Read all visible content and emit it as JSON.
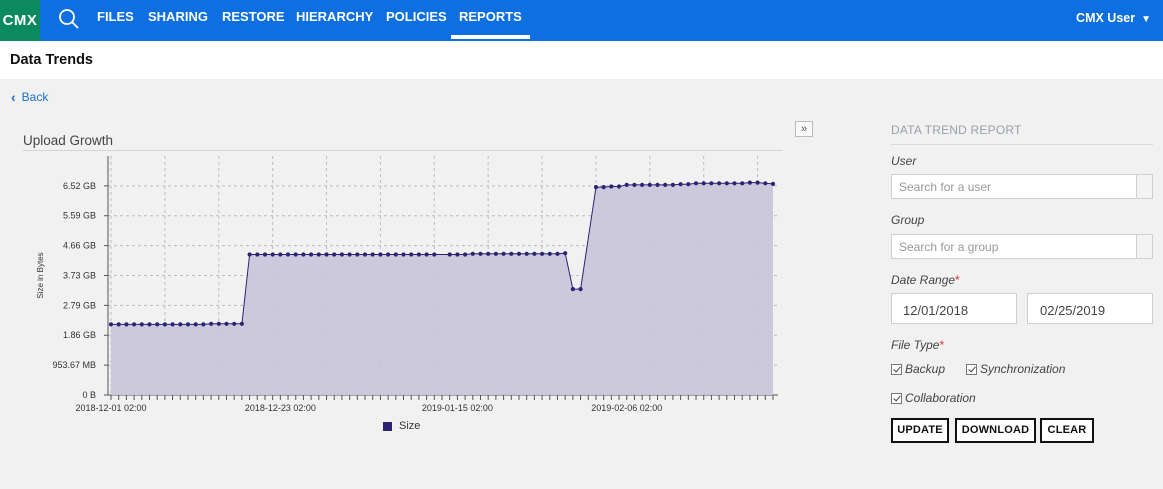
{
  "app": {
    "logo": "CMX",
    "search_icon": "search-icon",
    "user": "CMX User",
    "chevron_icon": "chevron-down-icon"
  },
  "nav": [
    {
      "label": "FILES",
      "active": false
    },
    {
      "label": "SHARING",
      "active": false
    },
    {
      "label": "RESTORE",
      "active": false
    },
    {
      "label": "HIERARCHY",
      "active": false
    },
    {
      "label": "POLICIES",
      "active": false
    },
    {
      "label": "REPORTS",
      "active": true
    }
  ],
  "page": {
    "title": "Data Trends",
    "back": "Back"
  },
  "chart": {
    "title": "Upload Growth",
    "collapse_label": "»"
  },
  "panel": {
    "title": "DATA TREND REPORT",
    "user_label": "User",
    "user_placeholder": "Search for a user",
    "group_label": "Group",
    "group_placeholder": "Search for a group",
    "date_range_label": "Date Range",
    "start_date": "12/01/2018",
    "end_date": "02/25/2019",
    "file_type_label": "File Type",
    "required_mark": "*",
    "checkboxes": [
      {
        "label": "Backup",
        "checked": true
      },
      {
        "label": "Synchronization",
        "checked": true
      },
      {
        "label": "Collaboration",
        "checked": true
      }
    ],
    "buttons": {
      "update": "UPDATE",
      "download": "DOWNLOAD",
      "clear": "CLEAR"
    }
  },
  "colors": {
    "nav_bg": "#0d6fe0",
    "logo_bg": "#0b8a5f",
    "series_line": "#2a2472",
    "series_fill": "#c9c6da"
  },
  "chart_data": {
    "type": "area",
    "title": "Upload Growth",
    "ylabel": "Size in Bytes",
    "xlabel": "",
    "ylim_gb": [
      0,
      7.45
    ],
    "y_ticks": [
      "0 B",
      "953.67 MB",
      "1.86 GB",
      "2.79 GB",
      "3.73 GB",
      "4.66 GB",
      "5.59 GB",
      "6.52 GB"
    ],
    "x_ticks": [
      "2018-12-01 02:00",
      "2018-12-23 02:00",
      "2019-01-15 02:00",
      "2019-02-06 02:00"
    ],
    "x_start": "2018-12-01",
    "x_end": "2019-02-25",
    "grid": true,
    "legend_position": "bottom",
    "series": [
      {
        "name": "Size",
        "points": [
          [
            "2018-12-01",
            2.2
          ],
          [
            "2018-12-02",
            2.2
          ],
          [
            "2018-12-03",
            2.2
          ],
          [
            "2018-12-04",
            2.2
          ],
          [
            "2018-12-05",
            2.2
          ],
          [
            "2018-12-06",
            2.2
          ],
          [
            "2018-12-07",
            2.2
          ],
          [
            "2018-12-08",
            2.2
          ],
          [
            "2018-12-09",
            2.2
          ],
          [
            "2018-12-10",
            2.2
          ],
          [
            "2018-12-11",
            2.2
          ],
          [
            "2018-12-12",
            2.2
          ],
          [
            "2018-12-13",
            2.2
          ],
          [
            "2018-12-14",
            2.22
          ],
          [
            "2018-12-15",
            2.22
          ],
          [
            "2018-12-16",
            2.22
          ],
          [
            "2018-12-17",
            2.22
          ],
          [
            "2018-12-18",
            2.22
          ],
          [
            "2018-12-19",
            4.38
          ],
          [
            "2018-12-20",
            4.38
          ],
          [
            "2018-12-21",
            4.38
          ],
          [
            "2018-12-22",
            4.38
          ],
          [
            "2018-12-23",
            4.38
          ],
          [
            "2018-12-24",
            4.38
          ],
          [
            "2018-12-25",
            4.38
          ],
          [
            "2018-12-26",
            4.38
          ],
          [
            "2018-12-27",
            4.38
          ],
          [
            "2018-12-28",
            4.38
          ],
          [
            "2018-12-29",
            4.38
          ],
          [
            "2018-12-30",
            4.38
          ],
          [
            "2018-12-31",
            4.38
          ],
          [
            "2019-01-01",
            4.38
          ],
          [
            "2019-01-02",
            4.38
          ],
          [
            "2019-01-03",
            4.38
          ],
          [
            "2019-01-04",
            4.38
          ],
          [
            "2019-01-05",
            4.38
          ],
          [
            "2019-01-06",
            4.38
          ],
          [
            "2019-01-07",
            4.38
          ],
          [
            "2019-01-08",
            4.38
          ],
          [
            "2019-01-09",
            4.38
          ],
          [
            "2019-01-10",
            4.38
          ],
          [
            "2019-01-11",
            4.38
          ],
          [
            "2019-01-12",
            4.38
          ],
          [
            "2019-01-14",
            4.38
          ],
          [
            "2019-01-15",
            4.38
          ],
          [
            "2019-01-16",
            4.38
          ],
          [
            "2019-01-17",
            4.4
          ],
          [
            "2019-01-18",
            4.4
          ],
          [
            "2019-01-19",
            4.4
          ],
          [
            "2019-01-20",
            4.4
          ],
          [
            "2019-01-21",
            4.4
          ],
          [
            "2019-01-22",
            4.4
          ],
          [
            "2019-01-23",
            4.4
          ],
          [
            "2019-01-24",
            4.4
          ],
          [
            "2019-01-25",
            4.4
          ],
          [
            "2019-01-26",
            4.4
          ],
          [
            "2019-01-27",
            4.4
          ],
          [
            "2019-01-28",
            4.4
          ],
          [
            "2019-01-29",
            4.42
          ],
          [
            "2019-01-30",
            3.3
          ],
          [
            "2019-01-31",
            3.3
          ],
          [
            "2019-02-02",
            6.48
          ],
          [
            "2019-02-03",
            6.48
          ],
          [
            "2019-02-04",
            6.5
          ],
          [
            "2019-02-05",
            6.5
          ],
          [
            "2019-02-06",
            6.55
          ],
          [
            "2019-02-07",
            6.55
          ],
          [
            "2019-02-08",
            6.55
          ],
          [
            "2019-02-09",
            6.55
          ],
          [
            "2019-02-10",
            6.55
          ],
          [
            "2019-02-11",
            6.55
          ],
          [
            "2019-02-12",
            6.55
          ],
          [
            "2019-02-13",
            6.57
          ],
          [
            "2019-02-14",
            6.57
          ],
          [
            "2019-02-15",
            6.6
          ],
          [
            "2019-02-16",
            6.6
          ],
          [
            "2019-02-17",
            6.6
          ],
          [
            "2019-02-18",
            6.6
          ],
          [
            "2019-02-19",
            6.6
          ],
          [
            "2019-02-20",
            6.6
          ],
          [
            "2019-02-21",
            6.6
          ],
          [
            "2019-02-22",
            6.62
          ],
          [
            "2019-02-23",
            6.62
          ],
          [
            "2019-02-24",
            6.6
          ],
          [
            "2019-02-25",
            6.58
          ]
        ]
      }
    ]
  }
}
